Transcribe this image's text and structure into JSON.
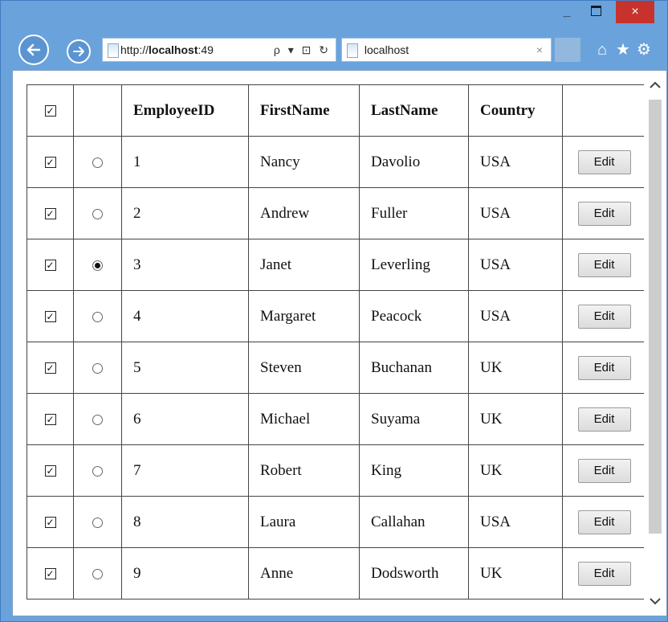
{
  "window": {
    "min_glyph": "_",
    "close_glyph": "×"
  },
  "nav": {
    "back_glyph": "←",
    "forward_glyph": "→",
    "address_prefix": "http://",
    "address_host": "localhost",
    "address_suffix": ":49",
    "address_tools": "ρ ▾ ⊡ ↻",
    "tab_title": "localhost",
    "tab_close": "×",
    "home_glyph": "⌂",
    "favorites_glyph": "★",
    "settings_glyph": "⚙"
  },
  "table": {
    "headers": [
      "EmployeeID",
      "FirstName",
      "LastName",
      "Country"
    ],
    "edit_label": "Edit",
    "checkmark": "✓",
    "rows": [
      {
        "id": "1",
        "first": "Nancy",
        "last": "Davolio",
        "country": "USA",
        "checked": true,
        "selected": false
      },
      {
        "id": "2",
        "first": "Andrew",
        "last": "Fuller",
        "country": "USA",
        "checked": true,
        "selected": false
      },
      {
        "id": "3",
        "first": "Janet",
        "last": "Leverling",
        "country": "USA",
        "checked": true,
        "selected": true
      },
      {
        "id": "4",
        "first": "Margaret",
        "last": "Peacock",
        "country": "USA",
        "checked": true,
        "selected": false
      },
      {
        "id": "5",
        "first": "Steven",
        "last": "Buchanan",
        "country": "UK",
        "checked": true,
        "selected": false
      },
      {
        "id": "6",
        "first": "Michael",
        "last": "Suyama",
        "country": "UK",
        "checked": true,
        "selected": false
      },
      {
        "id": "7",
        "first": "Robert",
        "last": "King",
        "country": "UK",
        "checked": true,
        "selected": false
      },
      {
        "id": "8",
        "first": "Laura",
        "last": "Callahan",
        "country": "USA",
        "checked": true,
        "selected": false
      },
      {
        "id": "9",
        "first": "Anne",
        "last": "Dodsworth",
        "country": "UK",
        "checked": true,
        "selected": false
      }
    ]
  },
  "scrollbar": {
    "up_glyph": "^",
    "down_glyph": "v"
  },
  "colors": {
    "frame": "#6aa3dc",
    "close_button": "#c7332c"
  }
}
